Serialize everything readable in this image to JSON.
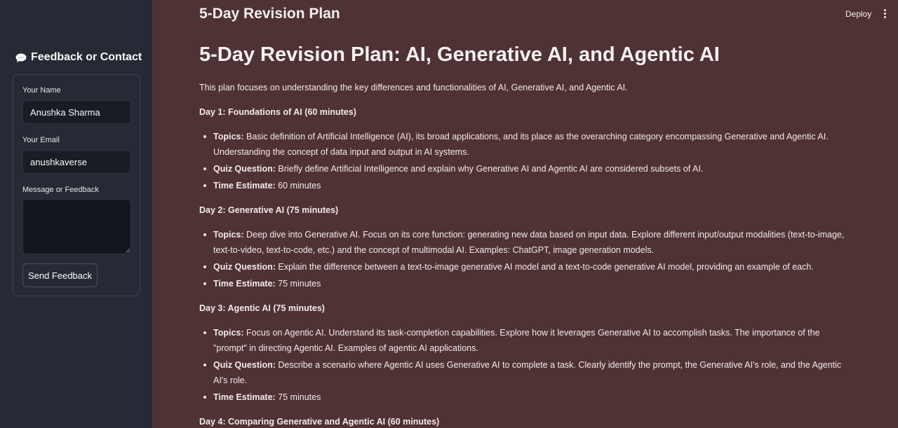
{
  "sidebar": {
    "header": "Feedback or Contact",
    "header_icon": "speech-balloon-icon",
    "form": {
      "name_label": "Your Name",
      "name_value": "Anushka Sharma",
      "email_label": "Your Email",
      "email_value": "anushkaverse",
      "message_label": "Message or Feedback",
      "message_value": "",
      "send_label": "Send Feedback"
    }
  },
  "header": {
    "title": "5-Day Revision Plan",
    "deploy_label": "Deploy"
  },
  "main": {
    "heading": "5-Day Revision Plan: AI, Generative AI, and Agentic AI",
    "intro": "This plan focuses on understanding the key differences and functionalities of AI, Generative AI, and Agentic AI.",
    "days": [
      {
        "title": "Day 1: Foundations of AI (60 minutes)",
        "items": [
          {
            "label": "Topics:",
            "text": " Basic definition of Artificial Intelligence (AI), its broad applications, and its place as the overarching category encompassing Generative and Agentic AI. Understanding the concept of data input and output in AI systems."
          },
          {
            "label": "Quiz Question:",
            "text": " Briefly define Artificial Intelligence and explain why Generative AI and Agentic AI are considered subsets of AI."
          },
          {
            "label": "Time Estimate:",
            "text": " 60 minutes"
          }
        ]
      },
      {
        "title": "Day 2: Generative AI (75 minutes)",
        "items": [
          {
            "label": "Topics:",
            "text": " Deep dive into Generative AI. Focus on its core function: generating new data based on input data. Explore different input/output modalities (text-to-image, text-to-video, text-to-code, etc.) and the concept of multimodal AI. Examples: ChatGPT, image generation models."
          },
          {
            "label": "Quiz Question:",
            "text": " Explain the difference between a text-to-image generative AI model and a text-to-code generative AI model, providing an example of each."
          },
          {
            "label": "Time Estimate:",
            "text": " 75 minutes"
          }
        ]
      },
      {
        "title": "Day 3: Agentic AI (75 minutes)",
        "items": [
          {
            "label": "Topics:",
            "text": " Focus on Agentic AI. Understand its task-completion capabilities. Explore how it leverages Generative AI to accomplish tasks. The importance of the \"prompt\" in directing Agentic AI. Examples of agentic AI applications."
          },
          {
            "label": "Quiz Question:",
            "text": " Describe a scenario where Agentic AI uses Generative AI to complete a task. Clearly identify the prompt, the Generative AI's role, and the Agentic AI's role."
          },
          {
            "label": "Time Estimate:",
            "text": " 75 minutes"
          }
        ]
      },
      {
        "title": "Day 4: Comparing Generative and Agentic AI (60 minutes)",
        "items": []
      }
    ]
  }
}
